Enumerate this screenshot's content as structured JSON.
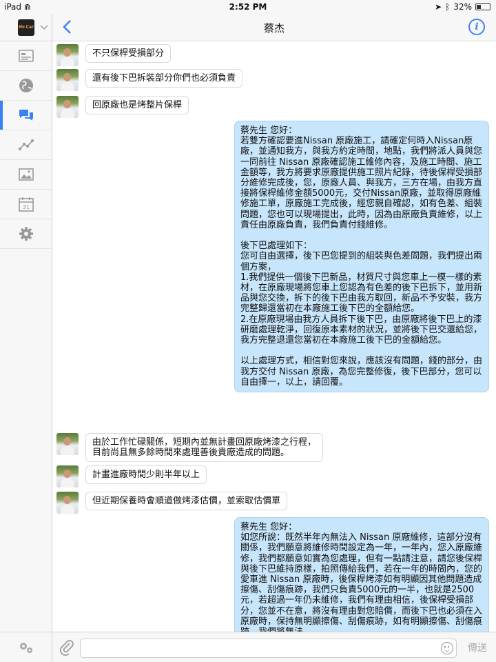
{
  "status_bar": {
    "device": "iPad",
    "time": "2:52 PM",
    "battery": "32%",
    "battery_level": 0.32
  },
  "header": {
    "title": "蔡杰"
  },
  "sidebar": {
    "logo_text": "Mr.Car",
    "items": [
      {
        "name": "card",
        "icon": "id-card-icon"
      },
      {
        "name": "globe",
        "icon": "globe-icon"
      },
      {
        "name": "chat",
        "icon": "chat-bubbles-icon",
        "active": true
      },
      {
        "name": "stats",
        "icon": "line-graph-icon"
      },
      {
        "name": "gallery",
        "icon": "image-icon"
      },
      {
        "name": "calendar",
        "icon": "calendar-icon",
        "text": "31"
      },
      {
        "name": "settings",
        "icon": "gear-icon"
      }
    ]
  },
  "messages": [
    {
      "dir": "in",
      "text": "不只保桿受損部分"
    },
    {
      "dir": "in",
      "text": "還有後下巴拆裝部分你們也必須負責"
    },
    {
      "dir": "in",
      "text": "回原廠也是烤整片保桿"
    },
    {
      "dir": "out",
      "text": "蔡先生 您好：\n若雙方確認要進Nissan 原廠施工，請確定何時入Nissan原廠，並通知我方，與我方約定時間，地點，我們將派人員與您一同前往 Nissan 原廠確認施工維修內容，及施工時間、施工金額等，我方將要求原廠提供施工照片紀錄，待後保桿受損部分維修完成後，您，原廠人員、與我方，三方在場，由我方直接將保桿維修金額5000元，交付Nissan原廠，並取得原廠維修施工單，原廠施工完成後，經您親自確認，如有色差、組裝問題，您也可以現場提出，此時，因為由原廠負責維修，以上責任由原廠負責，我們負責付錢維修。\n\n後下巴處理如下：\n您可自由選擇，後下巴您提到的組裝與色差問題，我們提出兩個方案，\n1.我們提供一個後下巴新品，材質尺寸與您車上一模一樣的素材，在原廠現場將您車上您認為有色差的後下巴拆下，並用新品與您交換，拆下的後下巴由我方取回，新品不予安裝，我方完整歸還當初在本廠施工後下巴的全額給您。\n2.在原廠現場由我方人員拆下後下巴，由原廠將後下巴上的漆研磨處理乾淨，回復原本素材的狀況，並將後下巴交還給您，我方完整退還您當初在本廠施工後下巴的金額給您。\n\n以上處理方式，相信對您來說，應該沒有問題，錢的部分，由我方交付 Nissan 原廠，為您完整修復，後下巴部分，您可以自由擇一，以上，請回覆。"
    },
    {
      "dir": "in",
      "text": "由於工作忙碌關係，短期內並無計畫回原廠烤漆之行程，\n目前尚且無多餘時間來處理善後貴廠造成的問題。"
    },
    {
      "dir": "in",
      "text": "計畫進廠時間少則半年以上"
    },
    {
      "dir": "in",
      "text": "但近期保養時會順道做烤漆估價，並索取估價單"
    },
    {
      "dir": "out",
      "text": "蔡先生 您好：\n如您所說：既然半年內無法入 Nissan 原廠維修，這部分沒有關係，我們願意將維修時間設定為一年，一年內，您入原廠維修，我們都願意如實為您處理，但有一點請注意，請您後保桿與後下巴維持原樣，拍照傳給我們，若在一年的時間內，您的愛車進 Nissan 原廠時，後保桿烤漆如有明顯因其他問題造成擦傷、刮傷痕跡，我們只負責5000元的一半，也就是2500元，若超過一年仍未維修，我們有理由相信，後保桿受損部分，您並不在意，將沒有理由對您賠償，而後下巴也必須在入原廠時，保持無明顯擦傷、刮傷痕跡，如有明顯擦傷、刮傷痕跡，我們將無法"
    }
  ],
  "input": {
    "placeholder": "",
    "send_label": "傳送"
  }
}
